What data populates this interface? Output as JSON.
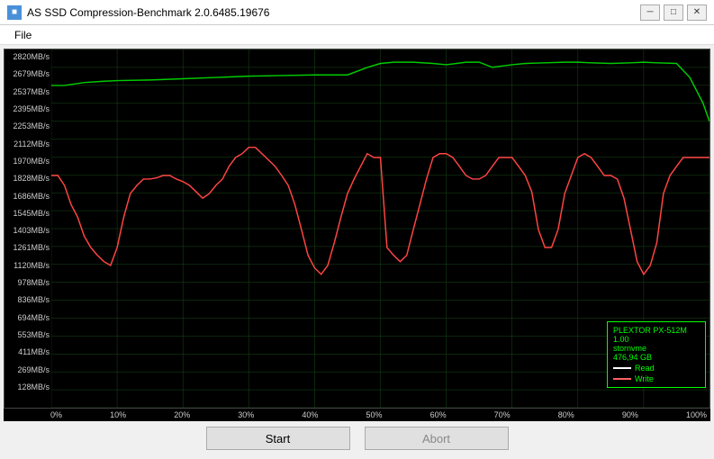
{
  "titleBar": {
    "title": "AS SSD Compression-Benchmark 2.0.6485.19676",
    "icon": "■",
    "minimizeLabel": "─",
    "restoreLabel": "□",
    "closeLabel": "✕"
  },
  "menuBar": {
    "items": [
      "File"
    ]
  },
  "chart": {
    "yLabels": [
      "2820MB/s",
      "2679MB/s",
      "2537MB/s",
      "2395MB/s",
      "2253MB/s",
      "2112MB/s",
      "1970MB/s",
      "1828MB/s",
      "1686MB/s",
      "1545MB/s",
      "1403MB/s",
      "1261MB/s",
      "1120MB/s",
      "978MB/s",
      "836MB/s",
      "694MB/s",
      "553MB/s",
      "411MB/s",
      "269MB/s",
      "128MB/s"
    ],
    "xLabels": [
      "0%",
      "10%",
      "20%",
      "30%",
      "40%",
      "50%",
      "60%",
      "70%",
      "80%",
      "90%",
      "100%"
    ],
    "legend": {
      "model": "PLEXTOR PX-512M",
      "value": "1.00",
      "type": "stornvme",
      "size": "476,94 GB",
      "readLabel": "Read",
      "writeLabel": "Write"
    }
  },
  "buttons": {
    "start": "Start",
    "abort": "Abort"
  }
}
